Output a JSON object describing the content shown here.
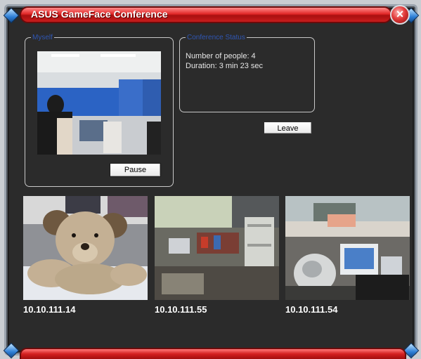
{
  "window": {
    "title": "ASUS GameFace Conference",
    "close_glyph": "×"
  },
  "myself": {
    "legend": "Myself",
    "pause_label": "Pause"
  },
  "status": {
    "legend": "Conference Status",
    "people": "Number of people: 4",
    "duration": "Duration: 3 min 23 sec",
    "leave_label": "Leave"
  },
  "participants": [
    {
      "ip": "10.10.111.14"
    },
    {
      "ip": "10.10.111.55"
    },
    {
      "ip": "10.10.111.54"
    }
  ],
  "colors": {
    "window_bg": "#2b2b2b",
    "titlebar_red": "#e02626",
    "legend_blue": "#2f56b3"
  }
}
